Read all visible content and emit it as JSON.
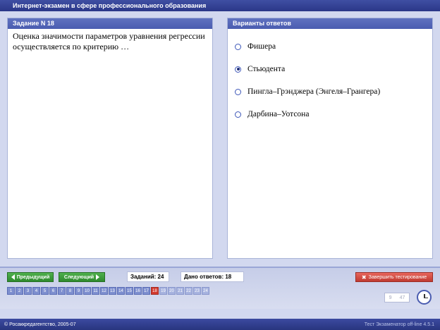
{
  "window": {
    "title": "Интернет-экзамен в сфере профессионального образования"
  },
  "question": {
    "header": "Задание N 18",
    "text": "Оценка значимости параметров уравнения регрессии осуществляется по критерию …"
  },
  "answers": {
    "header": "Варианты ответов",
    "options": [
      {
        "label": "Фишера",
        "selected": false
      },
      {
        "label": "Стьюдента",
        "selected": true
      },
      {
        "label": "Пингла–Грэнджера (Энгеля–Грангера)",
        "selected": false
      },
      {
        "label": "Дарбина–Уотсона",
        "selected": false
      }
    ]
  },
  "nav": {
    "prev_label": "Предыдущий",
    "next_label": "Следующий",
    "tasks_label": "Заданий: 24",
    "answered_label": "Дано ответов: 18",
    "finish_label": "Завершить тестирование",
    "pages": [
      "1",
      "2",
      "3",
      "4",
      "5",
      "6",
      "7",
      "8",
      "9",
      "10",
      "11",
      "12",
      "13",
      "14",
      "15",
      "16",
      "17",
      "18",
      "19",
      "20",
      "21",
      "22",
      "23",
      "24"
    ],
    "current_page": "18"
  },
  "timer": {
    "value1": "9",
    "value2": "47"
  },
  "status": {
    "left": "© Росаккредагентство, 2005-07",
    "right": "Тест Экзаменатор off-line 4.5.1"
  },
  "colors": {
    "titlebar": "#2b3788",
    "panel_header": "#4a5cb0",
    "nav_green": "#2f8a2e",
    "finish_red": "#c03a31",
    "current_page": "#d23a2f"
  }
}
